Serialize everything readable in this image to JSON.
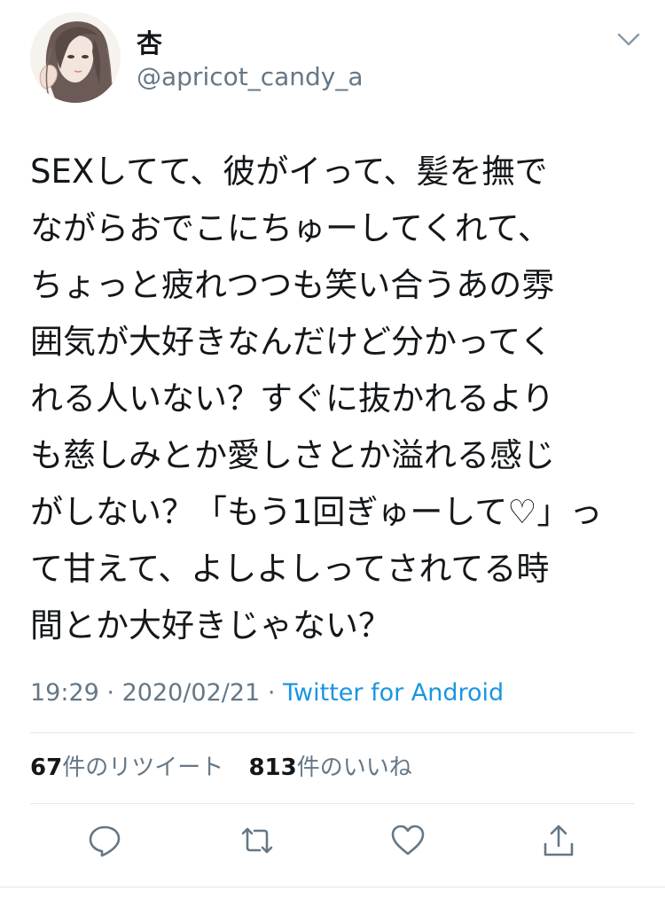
{
  "tweet": {
    "display_name": "杏",
    "handle": "@apricot_candy_a",
    "lines": [
      "SEXしてて、彼がイって、髪を撫で",
      "ながらおでこにちゅーしてくれて、",
      "ちょっと疲れつつも笑い合うあの雰",
      "囲気が大好きなんだけど分かってく",
      "れる人いない？すぐに抜かれるより",
      "も慈しみとか愛しさとか溢れる感じ",
      "がしない？「もう1回ぎゅーして♡」っ",
      "て甘えて、よしよしってされてる時",
      "間とか大好きじゃない？"
    ],
    "time": "19:29",
    "separator": "·",
    "date": "2020/02/21",
    "source": "Twitter for Android",
    "retweet_count": "67",
    "retweet_label": "件のリツイート",
    "like_count": "813",
    "like_label": "件のいいね"
  },
  "icons": {
    "more": "chevron-down-icon",
    "reply": "reply-icon",
    "retweet": "retweet-icon",
    "like": "heart-icon",
    "share": "share-icon"
  },
  "colors": {
    "text": "#14171a",
    "secondary": "#657786",
    "link": "#1b95e0",
    "divider": "#e1e8ed"
  }
}
